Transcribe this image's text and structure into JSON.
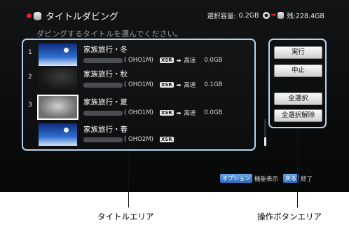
{
  "header": {
    "title": "タイトルダビング",
    "capacity_label": "選択容量:",
    "capacity_value": "0.2GB",
    "remaining_label": "残:228.4GB"
  },
  "prompt": "ダビングするタイトルを選んでください。",
  "titles": [
    {
      "num": "1",
      "name": "家族旅行・冬",
      "mode": "( OHO1M)",
      "rec": "XSR",
      "arrow": "➡",
      "speed": "高速",
      "size": "0.0GB"
    },
    {
      "num": "2",
      "name": "家族旅行・秋",
      "mode": "( OHO1M)",
      "rec": "XSR",
      "arrow": "➡",
      "speed": "高速",
      "size": "0.1GB"
    },
    {
      "num": "3",
      "name": "家族旅行・夏",
      "mode": "( OHO1M)",
      "rec": "XSR",
      "arrow": "➡",
      "speed": "高速",
      "size": "0.0GB"
    },
    {
      "num": "",
      "name": "家族旅行・春",
      "mode": "( OHO2M)",
      "rec": "XSR"
    }
  ],
  "buttons": {
    "execute": "実行",
    "stop": "中止",
    "select_all": "全選択",
    "deselect_all": "全選択解除"
  },
  "footer": {
    "option_key": "オプション",
    "option_label": "機能表示",
    "back_key": "戻る",
    "back_label": "終了"
  },
  "callouts": {
    "title_area": "タイトルエリア",
    "button_area": "操作ボタンエリア"
  },
  "colors": {
    "panel_border": "#b4d4ee",
    "header_accent": "#e01e2f",
    "footer_key": "#2c67b3"
  }
}
